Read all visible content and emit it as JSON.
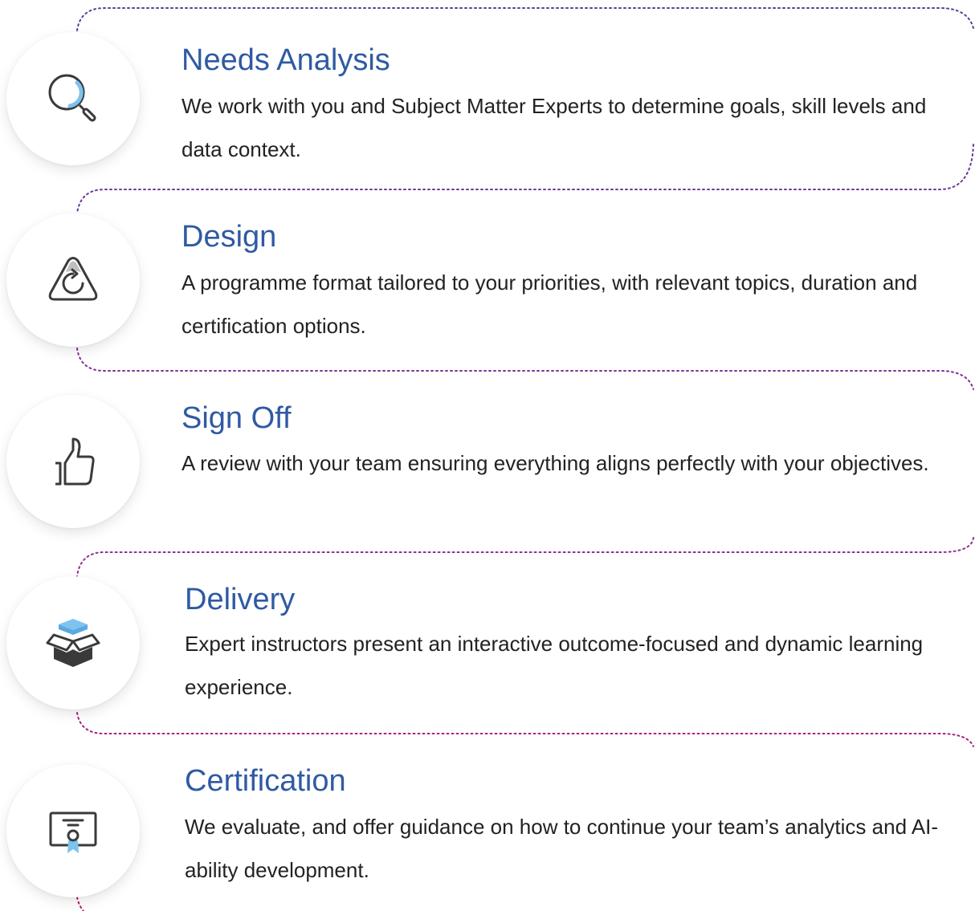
{
  "steps": [
    {
      "title": "Needs Analysis",
      "description": "We work with you and Subject Matter Experts to determine goals, skill levels and data context.",
      "icon": "magnifier-icon"
    },
    {
      "title": "Design",
      "description": "A programme format tailored to your priorities, with relevant topics, duration and certification options.",
      "icon": "design-triangle-icon"
    },
    {
      "title": "Sign Off",
      "description": "A review with your team ensuring everything aligns perfectly with your objectives.",
      "icon": "thumbs-up-icon"
    },
    {
      "title": "Delivery",
      "description": "Expert instructors present an interactive outcome-focused and dynamic learning experience.",
      "icon": "open-box-icon"
    },
    {
      "title": "Certification",
      "description": "We evaluate, and offer guidance on how to continue your team’s analytics and AI-ability development.",
      "icon": "certificate-icon"
    }
  ],
  "colors": {
    "title": "#2f5aa3",
    "text": "#222222",
    "icon_stroke": "#3a3a3a",
    "icon_accent": "#7ec3f0",
    "connector_purple": "#5a3d99",
    "connector_magenta": "#c2186b"
  }
}
